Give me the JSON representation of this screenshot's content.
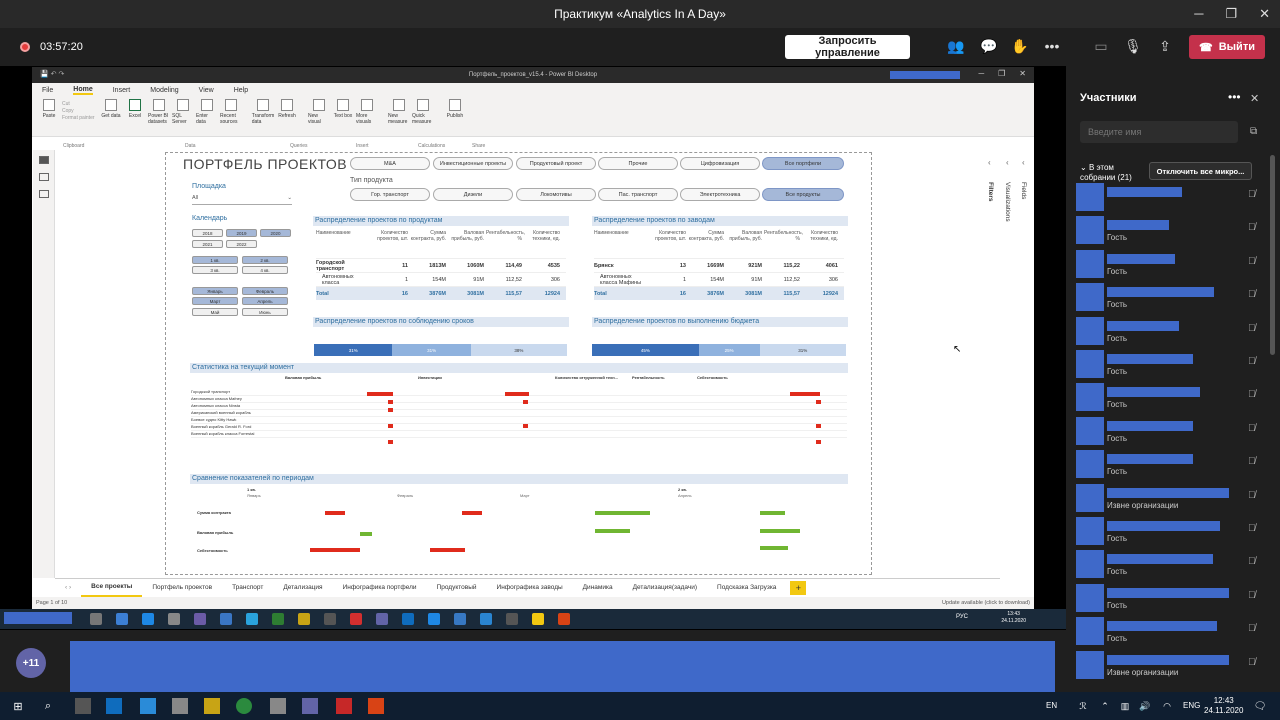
{
  "teams": {
    "window_title": "Практикум «Analytics In A Day»",
    "timer": "03:57:20",
    "request_control": "Запросить управление",
    "leave": "Выйти"
  },
  "pbi": {
    "file_title": "Портфель_проектов_v15.4 - Power BI Desktop",
    "ribbon_tabs": [
      "File",
      "Home",
      "Insert",
      "Modeling",
      "View",
      "Help"
    ],
    "ribbon_buttons": [
      "Paste",
      "Get data",
      "Excel",
      "Power BI datasets",
      "SQL Server",
      "Enter data",
      "Recent sources",
      "Transform data",
      "Refresh",
      "New visual",
      "Text box",
      "More visuals",
      "New measure",
      "Quick measure",
      "Publish"
    ],
    "clipboard_small": [
      "Cut",
      "Copy",
      "Format painter"
    ],
    "ribbon_groups": [
      "Clipboard",
      "Data",
      "Queries",
      "Insert",
      "Calculations",
      "Share"
    ],
    "report_title": "ПОРТФЕЛЬ ПРОЕКТОВ",
    "slicer_row1": [
      "M&A",
      "Инвестиционные проекты",
      "Продуктовый проект",
      "Прочие",
      "Цифровизация",
      "Все портфели"
    ],
    "type_label": "Тип продукта",
    "slicer_row2": [
      "Гор. транспорт",
      "Дизели",
      "Локомотивы",
      "Пас. транспорт",
      "Электротехника",
      "Все продукты"
    ],
    "area_label": "Площадка",
    "area_value": "All",
    "calendar_label": "Календарь",
    "years": [
      "2018",
      "2019",
      "2020",
      "2021",
      "2022"
    ],
    "quarters": [
      "1 кв.",
      "2 кв.",
      "3 кв.",
      "4 кв."
    ],
    "months": [
      "Январь",
      "Февраль",
      "Март",
      "Апрель",
      "Май",
      "Июнь"
    ],
    "prod_title": "Распределение проектов по продуктам",
    "plant_title": "Распределение проектов по заводам",
    "table_headers": [
      "Наименование",
      "Количество проектов, шт.",
      "Сумма контракта, руб.",
      "Валовая прибыль, руб.",
      "Рентабельность, %",
      "Количество техники, ед."
    ],
    "prod_rows": [
      {
        "name": "Городской транспорт",
        "v": [
          "11",
          "1813M",
          "1060M",
          "114,49",
          "4535"
        ]
      },
      {
        "name": "Автономных класса",
        "v": [
          "1",
          "154M",
          "91M",
          "112,52",
          "306"
        ]
      }
    ],
    "prod_total": {
      "name": "Total",
      "v": [
        "16",
        "3876M",
        "3081M",
        "115,57",
        "12924"
      ]
    },
    "plant_rows": [
      {
        "name": "Брянск",
        "v": [
          "13",
          "1669M",
          "921M",
          "115,22",
          "4061"
        ]
      },
      {
        "name": "Автономных класса Мафины",
        "v": [
          "1",
          "154M",
          "91M",
          "112,52",
          "306"
        ]
      }
    ],
    "plant_total": {
      "name": "Total",
      "v": [
        "16",
        "3876M",
        "3081M",
        "115,57",
        "12924"
      ]
    },
    "deadline_title": "Распределение проектов по соблюдению сроков",
    "budget_title": "Распределение проектов по выполнению бюджета",
    "deadline_bar": [
      "31%",
      "31%",
      "38%"
    ],
    "budget_bar": [
      "45%",
      "25%",
      "31%"
    ],
    "stats_title": "Статистика на текущий момент",
    "stats_cols": [
      "Валовая прибыль",
      "Инвестиции",
      "Количество отгруженной техн...",
      "Рентабельность",
      "Себестоимость"
    ],
    "stats_rows": [
      "Городской транспорт",
      "Автономных класса Mafney",
      "Автономных класса Ninsta",
      "Американский военный корабль",
      "Боевое судно Kitty Hawk",
      "Военный корабль Gerald R. Ford",
      "Военный корабль класса Forrestal"
    ],
    "compare_title": "Сравнение показателей по периодам",
    "compare_periods": [
      "1 кв.",
      "Январь",
      "Февраль",
      "Март",
      "2 кв.",
      "Апрель"
    ],
    "compare_rows": [
      "Сумма контракта",
      "Валовая прибыль",
      "Себестоимость"
    ],
    "pages": [
      "Все проекты",
      "Портфель проектов",
      "Транспорт",
      "Детализация",
      "Инфографика портфели",
      "Продуктовый",
      "Инфографика заводы",
      "Динамика",
      "Детализация(задачи)",
      "Подсказка Загрузка"
    ],
    "page_status": "Page 1 of 10",
    "update_status": "Update available (click to download)",
    "panes": [
      "Filters",
      "Visualizations",
      "Fields"
    ],
    "inner_lang": "РУС",
    "inner_time": "13:43",
    "inner_date": "24.11.2020"
  },
  "participants": {
    "title": "Участники",
    "search_placeholder": "Введите имя",
    "meeting_label": "В этом собрании (21)",
    "mute_all": "Отключить все микро...",
    "people": [
      {
        "role": "",
        "w": 75
      },
      {
        "role": "Гость",
        "w": 62
      },
      {
        "role": "Гость",
        "w": 68
      },
      {
        "role": "Гость",
        "w": 107
      },
      {
        "role": "Гость",
        "w": 72
      },
      {
        "role": "Гость",
        "w": 86
      },
      {
        "role": "Гость",
        "w": 93
      },
      {
        "role": "Гость",
        "w": 86
      },
      {
        "role": "Гость",
        "w": 86
      },
      {
        "role": "Извне организации",
        "w": 122
      },
      {
        "role": "Гость",
        "w": 113
      },
      {
        "role": "Гость",
        "w": 106
      },
      {
        "role": "Гость",
        "w": 122
      },
      {
        "role": "Гость",
        "w": 110
      },
      {
        "role": "Извне организации",
        "w": 122
      }
    ]
  },
  "gallery": {
    "more": "+11"
  },
  "taskbar": {
    "lang_short": "EN",
    "lang": "ENG",
    "time": "12:43",
    "date": "24.11.2020"
  }
}
